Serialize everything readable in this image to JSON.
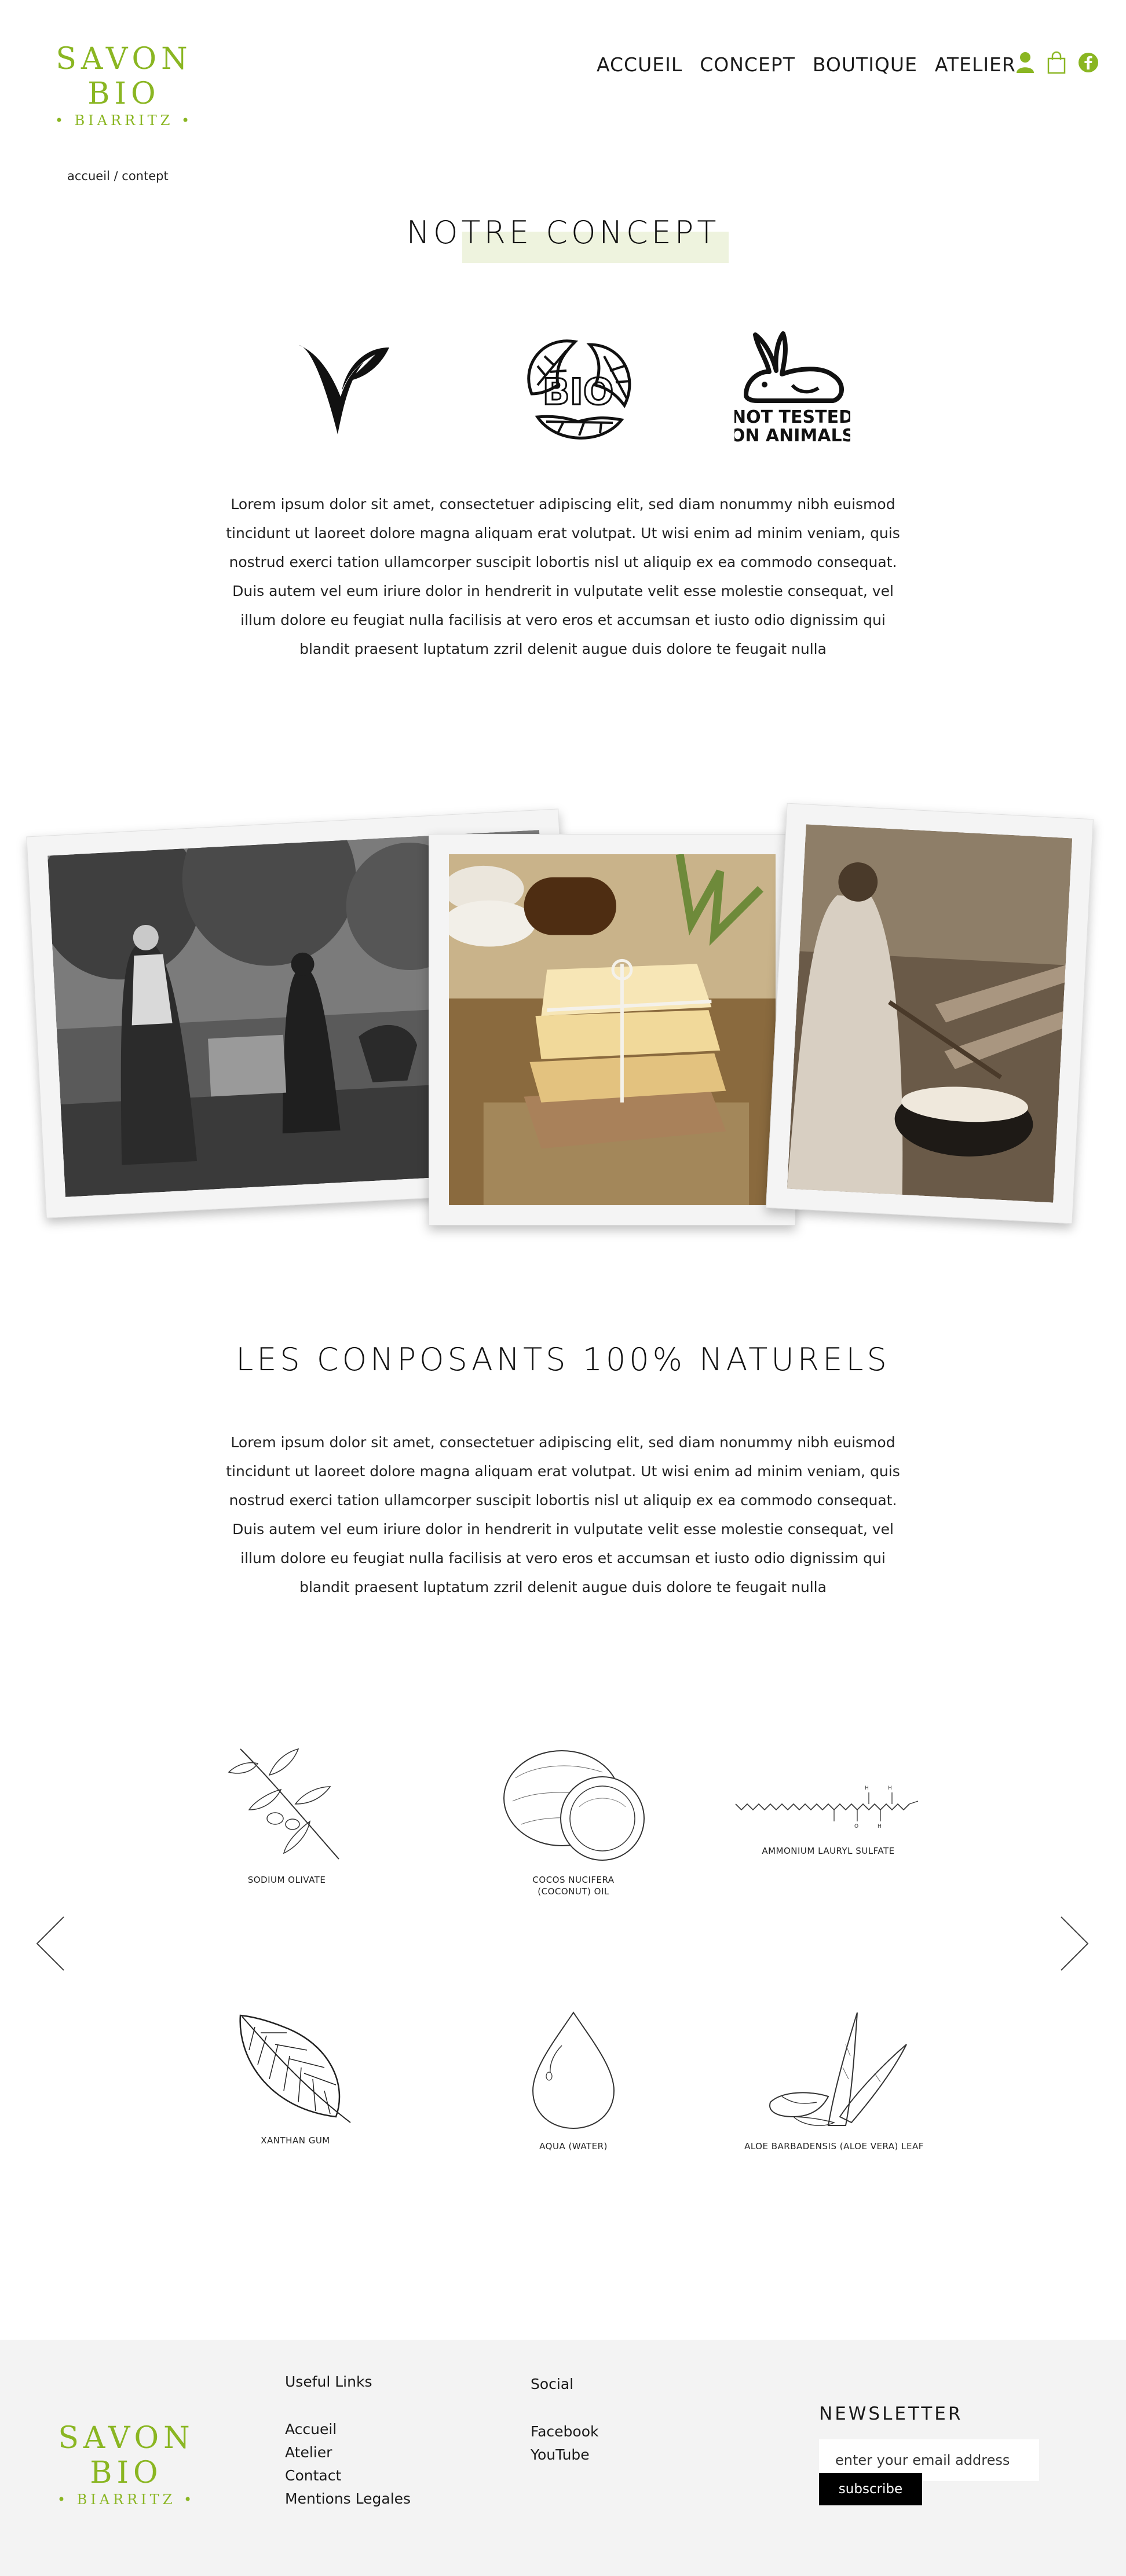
{
  "brand": {
    "name": "SAVON BIO",
    "subtitle": "• BIARRITZ •",
    "accent_color": "#8ab622"
  },
  "nav": {
    "items": [
      "ACCUEIL",
      "CONCEPT",
      "BOUTIQUE",
      "ATELIER"
    ],
    "icons": [
      "user-icon",
      "shopping-bag-icon",
      "facebook-icon"
    ]
  },
  "breadcrumb": "accueil / contept",
  "concept": {
    "title": "NOTRE CONCEPT",
    "badges": [
      "vegan-icon",
      "bio-icon",
      "not-tested-on-animals-icon"
    ],
    "badge_text_bio": "BIO",
    "badge_text_animals_1": "NOT TESTED",
    "badge_text_animals_2": "ON ANIMALS",
    "paragraph": "Lorem ipsum dolor sit amet, consectetuer adipiscing elit, sed diam nonummy nibh euismod tincidunt ut laoreet dolore magna aliquam erat volutpat. Ut wisi enim ad minim veniam, quis nostrud exerci tation ullamcorper suscipit lobortis nisl ut aliquip ex ea commodo consequat. Duis autem vel eum iriure dolor in hendrerit in vulputate velit esse molestie consequat, vel illum dolore eu feugiat nulla facilisis at vero eros et accumsan et iusto odio dignissim qui blandit praesent luptatum zzril delenit augue duis dolore te feugait nulla"
  },
  "ingredients": {
    "title": "LES CONPOSANTS 100% NATURELS",
    "paragraph": "Lorem ipsum dolor sit amet, consectetuer adipiscing elit, sed diam nonummy nibh euismod tincidunt ut laoreet dolore magna aliquam erat volutpat. Ut wisi enim ad minim veniam, quis nostrud exerci tation ullamcorper suscipit lobortis nisl ut aliquip ex ea commodo consequat. Duis autem vel eum iriure dolor in hendrerit in vulputate velit esse molestie consequat, vel illum dolore eu feugiat nulla facilisis at vero eros et accumsan et iusto odio dignissim qui blandit praesent luptatum zzril delenit augue duis dolore te feugait nulla",
    "items": [
      "SODIUM OLIVATE",
      "COCOS NUCIFERA\n(COCONUT) OIL",
      "AMMONIUM LAURYL SULFATE",
      "XANTHAN GUM",
      "AQUA (WATER)",
      "ALOE BARBADENSIS (ALOE VERA) LEAF"
    ]
  },
  "footer": {
    "useful_links_title": "Useful Links",
    "useful_links": [
      "Accueil",
      "Atelier",
      "Contact",
      "Mentions Legales"
    ],
    "social_title": "Social",
    "social_links": [
      "Facebook",
      "YouTube"
    ],
    "newsletter_title": "NEWSLETTER",
    "newsletter_placeholder": "enter your email address",
    "subscribe_label": "subscribe"
  }
}
